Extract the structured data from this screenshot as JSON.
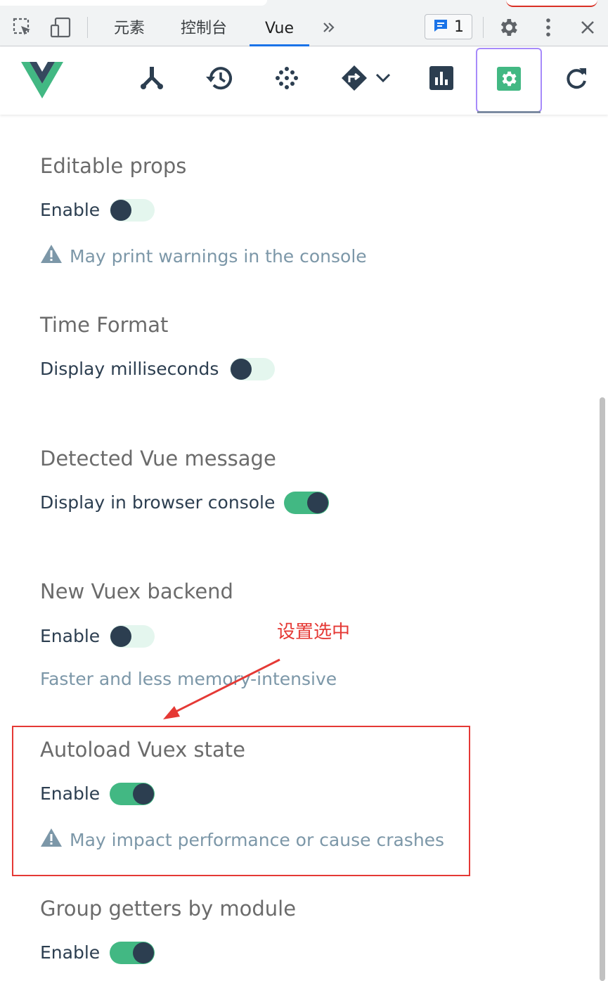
{
  "devtools": {
    "tabs": [
      {
        "label": "元素",
        "active": false
      },
      {
        "label": "控制台",
        "active": false
      },
      {
        "label": "Vue",
        "active": true
      }
    ],
    "issues_count": "1",
    "icons": [
      "inspect-element-icon",
      "device-toolbar-icon",
      "more-tabs-icon",
      "issues-icon",
      "gear-icon",
      "kebab-menu-icon",
      "close-icon"
    ]
  },
  "vue_toolbar": {
    "buttons": [
      "components",
      "timeline",
      "vuex",
      "routing",
      "performance",
      "settings",
      "refresh"
    ],
    "active": "settings"
  },
  "settings": {
    "editable_props": {
      "title": "Editable props",
      "label": "Enable",
      "enabled": false,
      "warning": "May print warnings in the console"
    },
    "time_format": {
      "title": "Time Format",
      "label": "Display milliseconds",
      "enabled": false
    },
    "detected_vue_message": {
      "title": "Detected Vue message",
      "label": "Display in browser console",
      "enabled": true
    },
    "new_vuex_backend": {
      "title": "New Vuex backend",
      "label": "Enable",
      "enabled": false,
      "note": "Faster and less memory-intensive"
    },
    "autoload_vuex_state": {
      "title": "Autoload Vuex state",
      "label": "Enable",
      "enabled": true,
      "warning": "May impact performance or cause crashes"
    },
    "group_getters": {
      "title": "Group getters by module",
      "label": "Enable",
      "enabled": true
    }
  },
  "annotation": {
    "text": "设置选中",
    "color": "#e53935"
  },
  "colors": {
    "vue_green": "#42b883",
    "vue_dark": "#2c3e50",
    "toggle_off_track": "#e4f6ee",
    "muted_note": "#7c97a8"
  }
}
